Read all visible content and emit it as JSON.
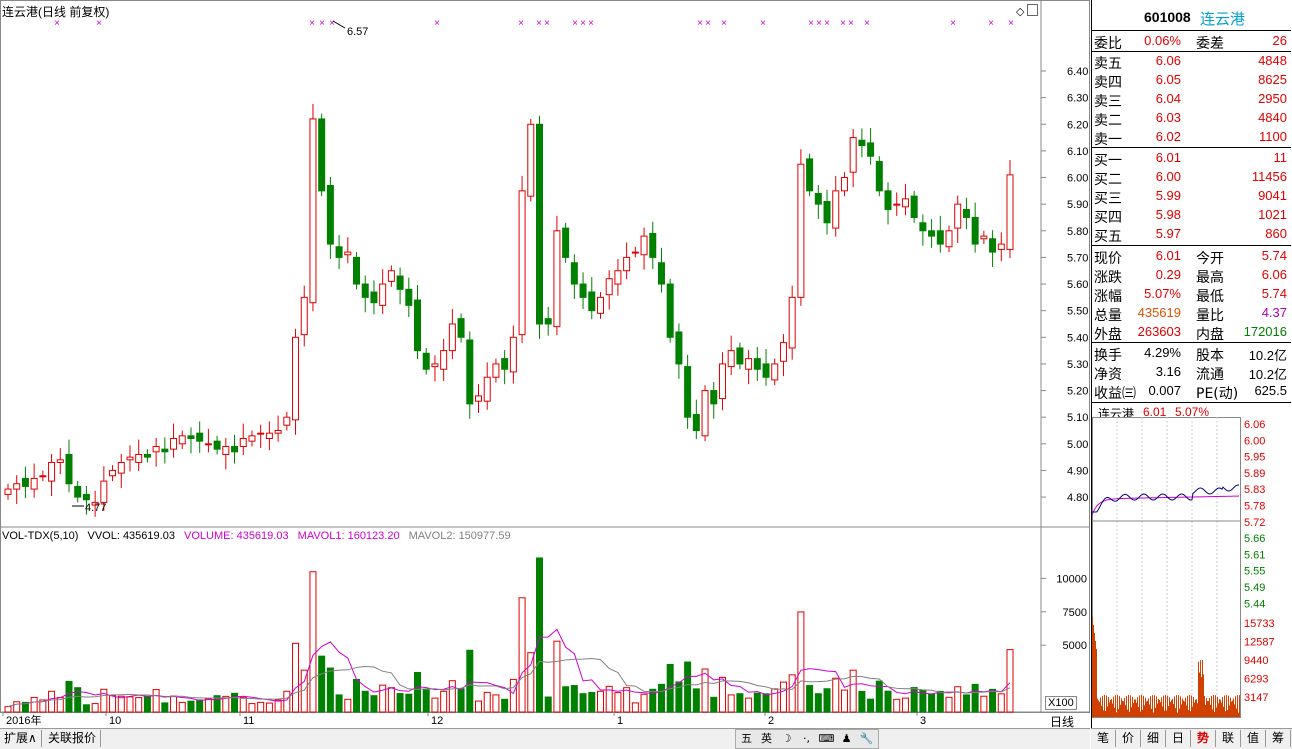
{
  "kline": {
    "title": "连云港(日线 前复权)",
    "high_label": "6.57",
    "low_label": "4.77",
    "y_ticks": [
      "6.40",
      "6.30",
      "6.20",
      "6.10",
      "6.00",
      "5.90",
      "5.80",
      "5.70",
      "5.60",
      "5.50",
      "5.40",
      "5.30",
      "5.20",
      "5.10",
      "5.00",
      "4.90",
      "4.80"
    ],
    "x_ticks": [
      "2016年",
      "10",
      "11",
      "12",
      "1",
      "2",
      "3"
    ],
    "period_label": "日线"
  },
  "volume": {
    "legend_name": "VOL-TDX(5,10)",
    "legend_vvol": "VVOL: 435619.03",
    "legend_volume": "VOLUME: 435619.03",
    "legend_mavol1": "MAVOL1: 160123.20",
    "legend_mavol2": "MAVOL2: 150977.59",
    "y_ticks": [
      "10000",
      "7500",
      "5000"
    ],
    "unit": "X100"
  },
  "quote": {
    "code": "601008",
    "name": "连云港",
    "weibi_label": "委比",
    "weibi": "0.06%",
    "weicha_label": "委差",
    "weicha": "26",
    "asks": [
      {
        "label": "卖五",
        "price": "6.06",
        "vol": "4848"
      },
      {
        "label": "卖四",
        "price": "6.05",
        "vol": "8625"
      },
      {
        "label": "卖三",
        "price": "6.04",
        "vol": "2950"
      },
      {
        "label": "卖二",
        "price": "6.03",
        "vol": "4840"
      },
      {
        "label": "卖一",
        "price": "6.02",
        "vol": "1100"
      }
    ],
    "bids": [
      {
        "label": "买一",
        "price": "6.01",
        "vol": "11"
      },
      {
        "label": "买二",
        "price": "6.00",
        "vol": "11456"
      },
      {
        "label": "买三",
        "price": "5.99",
        "vol": "9041"
      },
      {
        "label": "买四",
        "price": "5.98",
        "vol": "1021"
      },
      {
        "label": "买五",
        "price": "5.97",
        "vol": "860"
      }
    ],
    "stats": [
      {
        "l1": "现价",
        "v1": "6.01",
        "l2": "今开",
        "v2": "5.74",
        "c1": "red",
        "c2": "red"
      },
      {
        "l1": "涨跌",
        "v1": "0.29",
        "l2": "最高",
        "v2": "6.06",
        "c1": "red",
        "c2": "red"
      },
      {
        "l1": "涨幅",
        "v1": "5.07%",
        "l2": "最低",
        "v2": "5.74",
        "c1": "red",
        "c2": "red"
      },
      {
        "l1": "总量",
        "v1": "435619",
        "l2": "量比",
        "v2": "4.37",
        "c1": "orange",
        "c2": "purple"
      },
      {
        "l1": "外盘",
        "v1": "263603",
        "l2": "内盘",
        "v2": "172016",
        "c1": "red",
        "c2": "green"
      }
    ],
    "stats2": [
      {
        "l1": "换手",
        "v1": "4.29%",
        "l2": "股本",
        "v2": "10.2亿"
      },
      {
        "l1": "净资",
        "v1": "3.16",
        "l2": "流通",
        "v2": "10.2亿"
      },
      {
        "l1": "收益㈢",
        "v1": "0.007",
        "l2": "PE(动)",
        "v2": "625.5"
      }
    ]
  },
  "mini": {
    "name": "连云港",
    "price": "6.01",
    "pct": "5.07%",
    "price_ticks": [
      "6.06",
      "6.00",
      "5.95",
      "5.89",
      "5.83",
      "5.78",
      "5.72",
      "5.66",
      "5.61",
      "5.55",
      "5.49",
      "5.44"
    ],
    "vol_ticks": [
      "15733",
      "12587",
      "9440",
      "6293",
      "3147"
    ]
  },
  "bottom_tabs": [
    "扩展∧",
    "关联报价"
  ],
  "ime": [
    "五",
    "英",
    "☽",
    "·,",
    "⌨",
    "♟",
    "🔧"
  ],
  "right_tabs": [
    "笔",
    "价",
    "细",
    "日",
    "势",
    "联",
    "值",
    "筹"
  ],
  "right_tab_active": "势",
  "colors": {
    "up": "#e00000",
    "down": "#008000",
    "mavol1": "#d000d0",
    "mavol2": "#808080"
  }
}
